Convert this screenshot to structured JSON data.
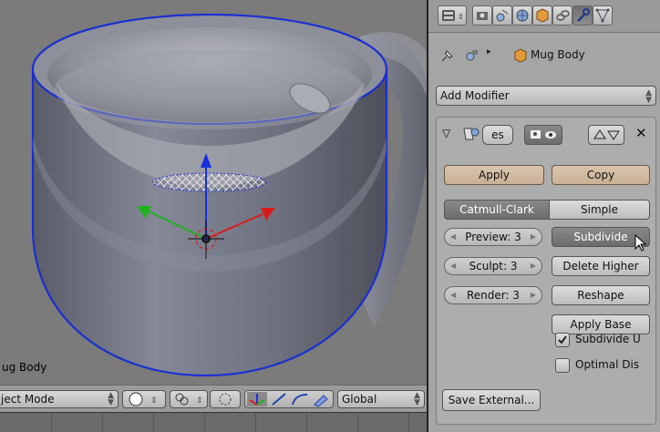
{
  "viewport": {
    "object_name": "ug Body",
    "mode": "ject Mode",
    "orientation": "Global"
  },
  "properties": {
    "breadcrumb_object": "Mug Body",
    "add_modifier": "Add Modifier",
    "modifier": {
      "name_fragment": "es",
      "apply": "Apply",
      "copy": "Copy",
      "type_catmull": "Catmull-Clark",
      "type_simple": "Simple",
      "preview": "Preview: 3",
      "sculpt": "Sculpt: 3",
      "render": "Render: 3",
      "subdivide": "Subdivide",
      "delete_higher": "Delete Higher",
      "reshape": "Reshape",
      "apply_base": "Apply Base",
      "subdivide_uvs": "Subdivide U",
      "optimal_display": "Optimal Dis",
      "save_external": "Save External..."
    }
  },
  "colors": {
    "mesh": "#6e7180",
    "outline": "#1a2fd0",
    "axis_x": "#d81c1c",
    "axis_y": "#1fb21f",
    "axis_z": "#1a2fe0",
    "panel_bg": "#a5a5a5"
  }
}
